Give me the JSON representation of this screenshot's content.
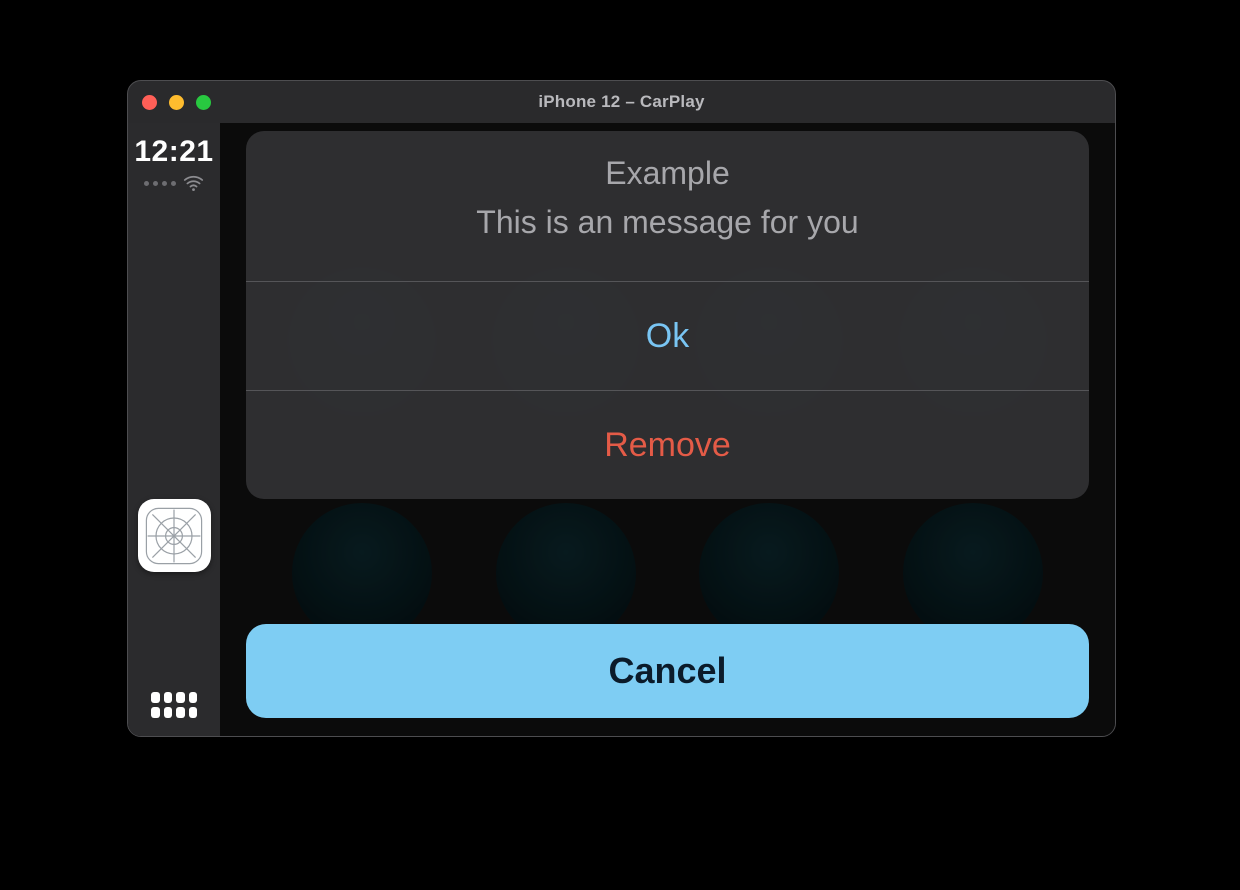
{
  "window": {
    "title": "iPhone 12 – CarPlay",
    "traffic_lights": {
      "close": "#ff5f57",
      "minimize": "#febc2e",
      "zoom": "#28c840"
    }
  },
  "sidebar": {
    "clock": "12:21",
    "signal_dots": 4,
    "wifi_icon": "wifi",
    "active_app_icon": "app-placeholder",
    "home_icon": "apps-grid"
  },
  "action_sheet": {
    "title": "Example",
    "message": "This is an message for you",
    "actions": [
      {
        "label": "Ok",
        "style": "default"
      },
      {
        "label": "Remove",
        "style": "destructive"
      }
    ],
    "cancel_label": "Cancel"
  },
  "colors": {
    "accent": "#79c5f3",
    "destructive": "#e45b47",
    "cancel_bg": "#7ecdf3"
  }
}
